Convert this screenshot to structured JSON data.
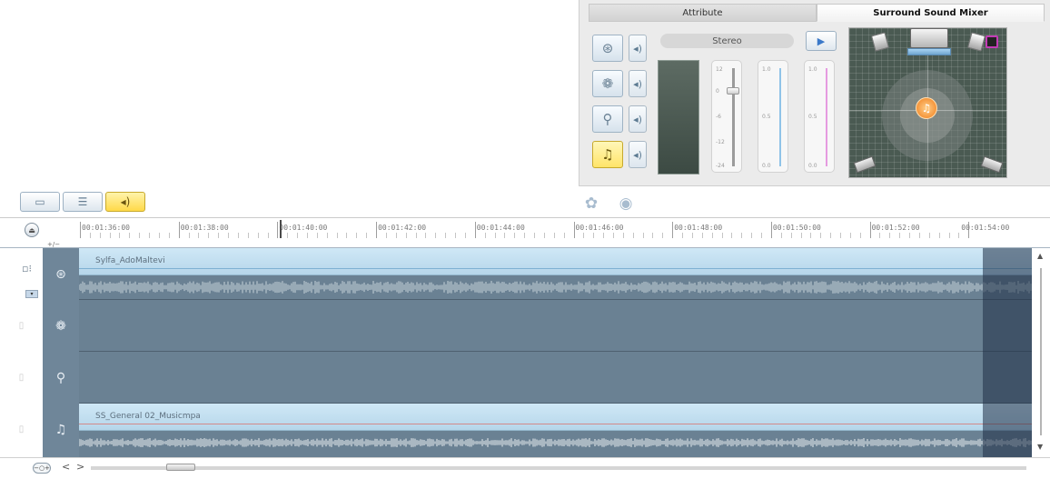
{
  "panel": {
    "tabs": [
      {
        "label": "Attribute",
        "active": false
      },
      {
        "label": "Surround Sound Mixer",
        "active": true
      }
    ],
    "mode_label": "Stereo",
    "track_buttons": [
      {
        "icon": "video-reel-icon",
        "selected": false
      },
      {
        "icon": "overlay-reel-icon",
        "selected": false
      },
      {
        "icon": "microphone-icon",
        "selected": false
      },
      {
        "icon": "music-note-icon",
        "selected": true
      }
    ],
    "volume_slider": {
      "ticks": [
        "12",
        "0",
        "-6",
        "-12",
        "-24"
      ]
    },
    "front_meter": {
      "ticks": [
        "1.0",
        "0.5",
        "0.0"
      ]
    },
    "rear_meter": {
      "ticks": [
        "1.0",
        "0.5",
        "0.0"
      ]
    }
  },
  "toolbar": {
    "buttons": [
      {
        "icon": "storyboard-view-icon",
        "active": false
      },
      {
        "icon": "timeline-view-icon",
        "active": false
      },
      {
        "icon": "audio-view-icon",
        "active": true
      }
    ]
  },
  "ruler": {
    "zoom_label": "+/−",
    "timecodes": [
      "00:01:36:00",
      "00:01:38:00",
      "00:01:40:00",
      "00:01:42:00",
      "00:01:44:00",
      "00:01:46:00",
      "00:01:48:00",
      "00:01:50:00",
      "00:01:52:00",
      "00:01:54:00"
    ]
  },
  "tracks": [
    {
      "icon": "video-reel-icon",
      "clip": "Sylfa_AdoMaltevi",
      "band": "blue"
    },
    {
      "icon": "overlay-reel-icon",
      "clip": "",
      "band": "none"
    },
    {
      "icon": "microphone-icon",
      "clip": "",
      "band": "none"
    },
    {
      "icon": "music-note-icon",
      "clip": "SS_General 02_Musicmpa",
      "band": "red"
    }
  ],
  "bottom": {
    "zoom_label": "−○+",
    "prev": "<",
    "next": ">"
  }
}
